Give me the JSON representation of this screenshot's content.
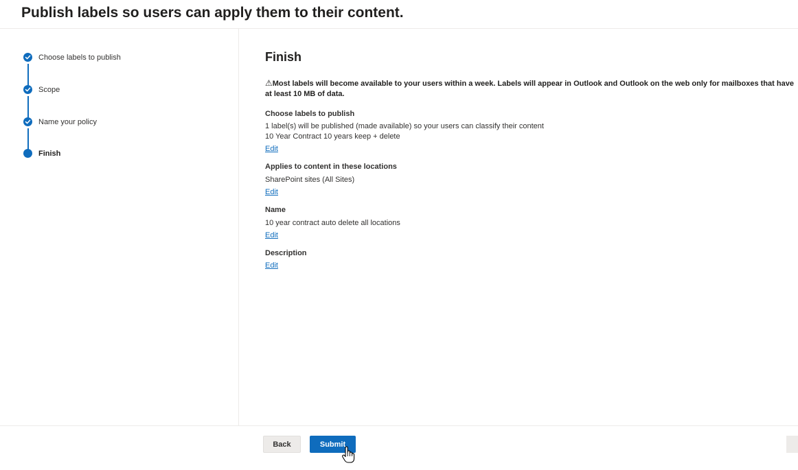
{
  "page": {
    "title": "Publish labels so users can apply them to their content."
  },
  "steps": [
    {
      "label": "Choose labels to publish",
      "state": "completed",
      "icon": "check-icon"
    },
    {
      "label": "Scope",
      "state": "completed",
      "icon": "check-icon"
    },
    {
      "label": "Name your policy",
      "state": "completed",
      "icon": "check-icon"
    },
    {
      "label": "Finish",
      "state": "current",
      "icon": "dot-icon"
    }
  ],
  "main": {
    "title": "Finish",
    "warning_icon": "⚠",
    "warning": "Most labels will become available to your users within a week. Labels will appear in Outlook and Outlook on the web only for mailboxes that have at least 10 MB of data.",
    "sections": {
      "labels": {
        "heading": "Choose labels to publish",
        "line1": "1 label(s) will be published (made available) so your users can classify their content",
        "line2": "10 Year Contract 10 years keep + delete",
        "edit": "Edit"
      },
      "locations": {
        "heading": "Applies to content in these locations",
        "line1": "SharePoint sites (All Sites)",
        "edit": "Edit"
      },
      "name": {
        "heading": "Name",
        "line1": "10 year contract auto delete all locations",
        "edit": "Edit"
      },
      "description": {
        "heading": "Description",
        "edit": "Edit"
      }
    }
  },
  "footer": {
    "back_label": "Back",
    "submit_label": "Submit"
  },
  "colors": {
    "accent": "#0f6cbd",
    "border": "#edebe9",
    "button_secondary": "#edebe9"
  }
}
